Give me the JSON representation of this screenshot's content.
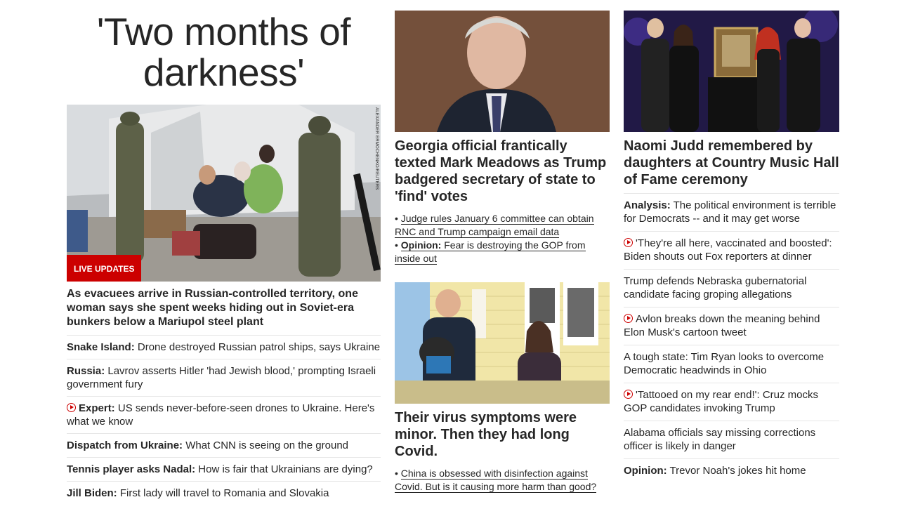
{
  "col1": {
    "headline": "'Two months of darkness'",
    "photo_credit": "ALEXANDER ERMOCHENKO/REUTERS",
    "badge": "LIVE UPDATES",
    "lede": "As evacuees arrive in Russian-controlled territory, one woman says she spent weeks hiding out in Soviet-era bunkers below a Mariupol steel plant",
    "items": [
      {
        "bold": "Snake Island:",
        "text": " Drone destroyed Russian patrol ships, says Ukraine",
        "video": false
      },
      {
        "bold": "Russia:",
        "text": " Lavrov asserts Hitler 'had Jewish blood,' prompting Israeli government fury",
        "video": false
      },
      {
        "bold": "Expert:",
        "text": " US sends never-before-seen drones to Ukraine. Here's what we know",
        "video": true
      },
      {
        "bold": "Dispatch from Ukraine:",
        "text": " What CNN is seeing on the ground",
        "video": false
      },
      {
        "bold": "Tennis player asks Nadal:",
        "text": " How is fair that Ukrainians are dying?",
        "video": false
      },
      {
        "bold": "Jill Biden:",
        "text": " First lady will travel to Romania and Slovakia",
        "video": false
      }
    ]
  },
  "col2": {
    "story1": {
      "headline": "Georgia official frantically texted Mark Meadows as Trump badgered secretary of state to 'find' votes",
      "sub1": "Judge rules January 6 committee can obtain RNC and Trump campaign email data",
      "sub2_bold": "Opinion:",
      "sub2_text": " Fear is destroying the GOP from inside out"
    },
    "story2": {
      "headline": "Their virus symptoms were minor. Then they had long Covid.",
      "sub1": "China is obsessed with disinfection against Covid. But is it causing more harm than good?"
    }
  },
  "col3": {
    "headline": "Naomi Judd remembered by daughters at Country Music Hall of Fame ceremony",
    "items": [
      {
        "bold": "Analysis:",
        "text": " The political environment is terrible for Democrats -- and it may get worse",
        "video": false
      },
      {
        "bold": "",
        "text": "'They're all here, vaccinated and boosted': Biden shouts out Fox reporters at dinner",
        "video": true
      },
      {
        "bold": "",
        "text": "Trump defends Nebraska gubernatorial candidate facing groping allegations",
        "video": false
      },
      {
        "bold": "",
        "text": "Avlon breaks down the meaning behind Elon Musk's cartoon tweet",
        "video": true
      },
      {
        "bold": "",
        "text": "A tough state: Tim Ryan looks to overcome Democratic headwinds in Ohio",
        "video": false
      },
      {
        "bold": "",
        "text": "'Tattooed on my rear end!': Cruz mocks GOP candidates invoking Trump",
        "video": true
      },
      {
        "bold": "",
        "text": "Alabama officials say missing corrections officer is likely in danger",
        "video": false
      },
      {
        "bold": "Opinion:",
        "text": " Trevor Noah's jokes hit home",
        "video": false
      }
    ]
  }
}
